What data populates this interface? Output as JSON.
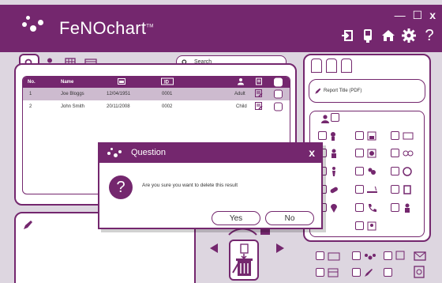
{
  "app": {
    "title": "FeNOchart",
    "trademark": "TM"
  },
  "window_controls": {
    "minimize": "—",
    "maximize": "☐",
    "close": "x"
  },
  "header_icons": [
    "export-icon",
    "device-icon",
    "home-icon",
    "settings-icon",
    "help-icon"
  ],
  "search": {
    "placeholder": "Search"
  },
  "table": {
    "columns": [
      "No.",
      "Name",
      "",
      "",
      "",
      "",
      ""
    ],
    "rows": [
      {
        "no": "1",
        "name": "Joe Bloggs",
        "dob": "12/04/1951",
        "id": "0001",
        "type": "Adult",
        "selected": true
      },
      {
        "no": "2",
        "name": "John Smith",
        "dob": "20/11/2008",
        "id": "0002",
        "type": "Child",
        "selected": false
      }
    ]
  },
  "report": {
    "title": "Report Title (PDF)"
  },
  "dialog": {
    "title": "Question",
    "close": "x",
    "message": "Are you sure you want to delete this result",
    "yes": "Yes",
    "no": "No"
  },
  "colors": {
    "accent": "#74276e",
    "selected_row": "#cdbbcf",
    "background": "#ddd6e0"
  }
}
